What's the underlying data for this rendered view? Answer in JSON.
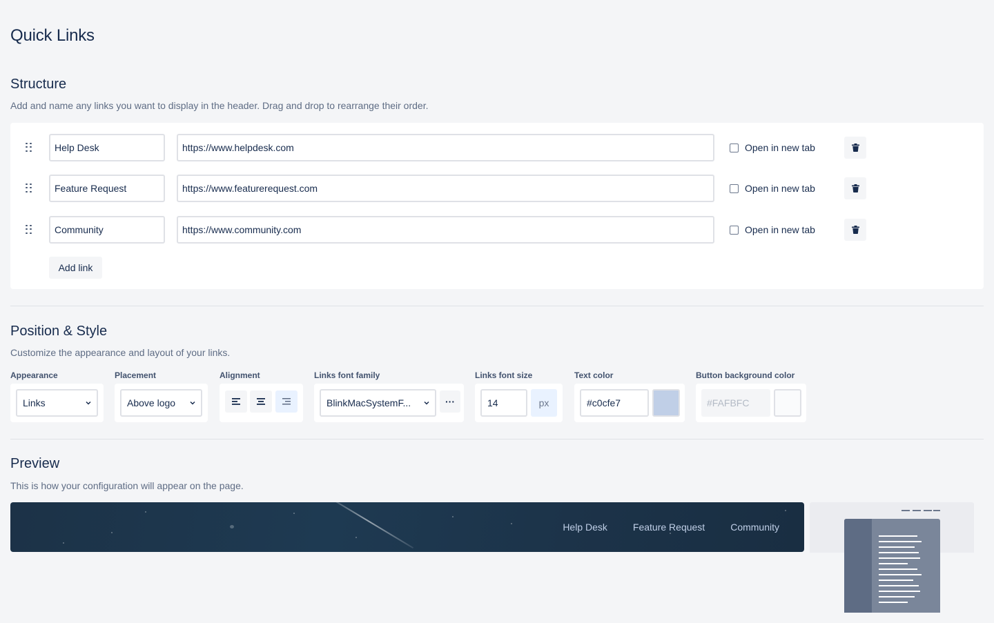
{
  "page": {
    "title": "Quick Links"
  },
  "structure": {
    "title": "Structure",
    "description": "Add and name any links you want to display in the header. Drag and drop to rearrange their order.",
    "links": [
      {
        "name": "Help Desk",
        "url": "https://www.helpdesk.com",
        "new_tab_label": "Open in new tab",
        "new_tab_checked": false
      },
      {
        "name": "Feature Request",
        "url": "https://www.featurerequest.com",
        "new_tab_label": "Open in new tab",
        "new_tab_checked": false
      },
      {
        "name": "Community",
        "url": "https://www.community.com",
        "new_tab_label": "Open in new tab",
        "new_tab_checked": false
      }
    ],
    "add_link_label": "Add link"
  },
  "style": {
    "title": "Position & Style",
    "description": "Customize the appearance and layout of your links.",
    "appearance": {
      "label": "Appearance",
      "value": "Links"
    },
    "placement": {
      "label": "Placement",
      "value": "Above logo"
    },
    "alignment": {
      "label": "Alignment",
      "options": [
        "left",
        "center",
        "right"
      ],
      "selected": "right"
    },
    "font_family": {
      "label": "Links font family",
      "value": "BlinkMacSystemF...",
      "more_label": "···"
    },
    "font_size": {
      "label": "Links font size",
      "value": "14",
      "unit": "px"
    },
    "text_color": {
      "label": "Text color",
      "value": "#c0cfe7",
      "swatch": "#c0cfe7"
    },
    "button_bg": {
      "label": "Button background color",
      "placeholder": "#FAFBFC",
      "swatch": "#FAFBFC"
    }
  },
  "preview": {
    "title": "Preview",
    "description": "This is how your configuration will appear on the page.",
    "links": [
      "Help Desk",
      "Feature Request",
      "Community"
    ]
  },
  "colors": {
    "accent_light": "#e9f2ff",
    "text_primary": "#172b4d",
    "text_secondary": "#5e6c84",
    "banner_bg": "#1c3247"
  }
}
